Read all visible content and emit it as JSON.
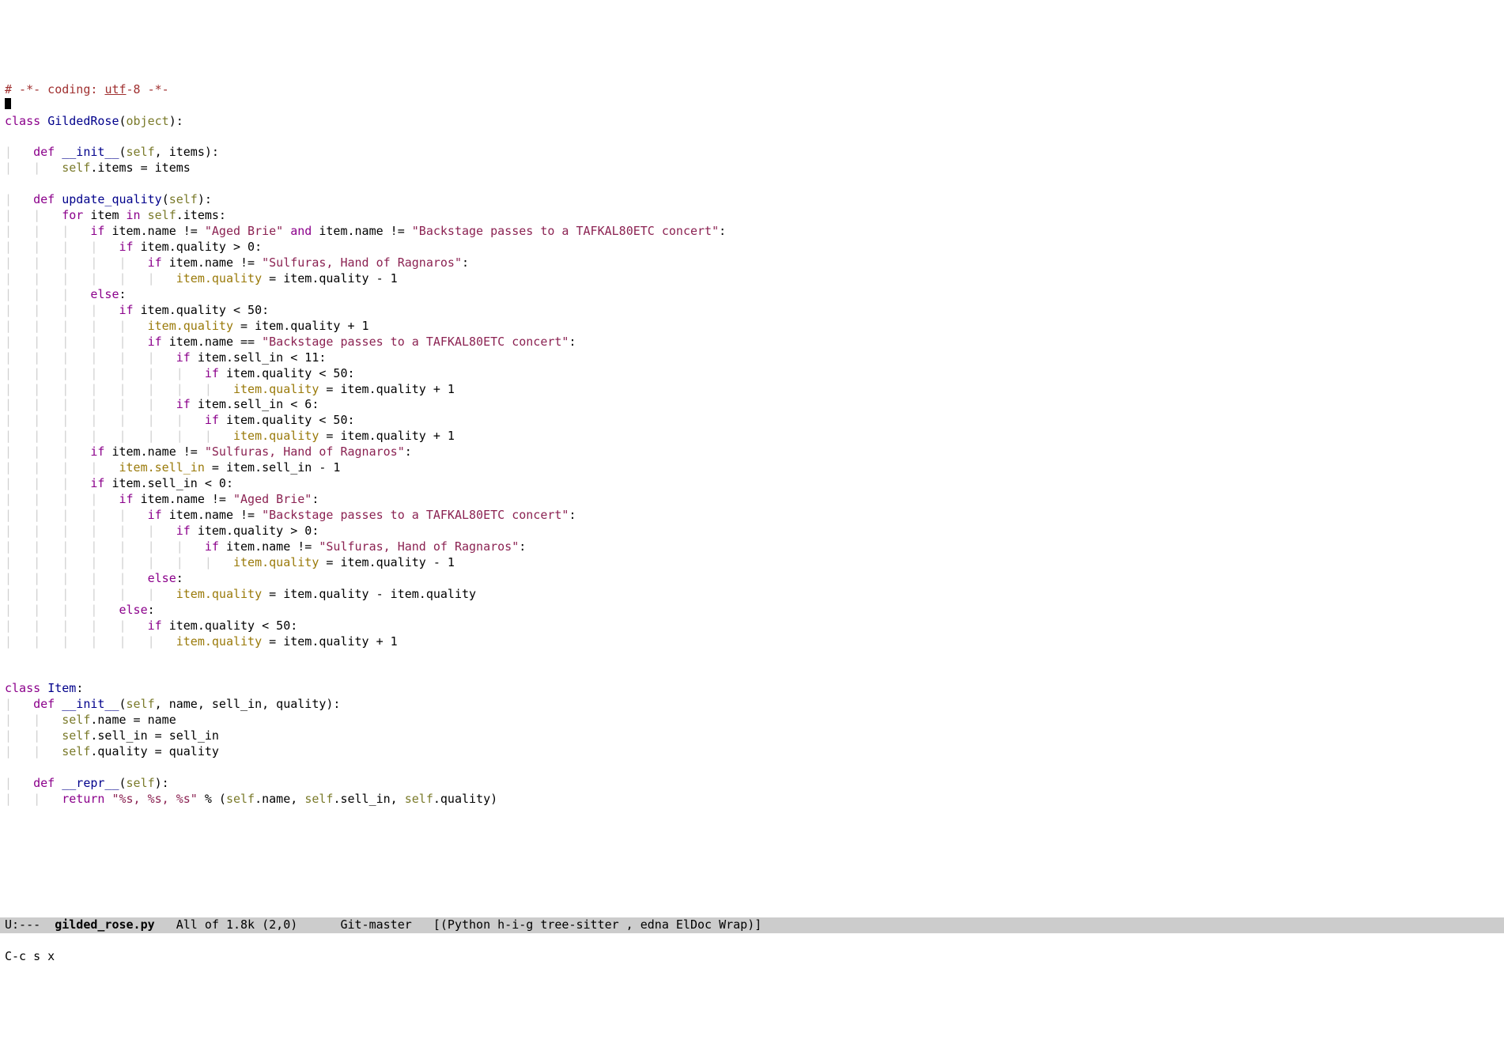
{
  "code": {
    "l1_pre": "# -*- coding: ",
    "l1_utf": "utf",
    "l1_post": "-8 -*-",
    "class_kw": "class",
    "def_kw": "def",
    "for_kw": "for",
    "in_kw": "in",
    "if_kw": "if",
    "else_kw": "else",
    "and_kw": "and",
    "return_kw": "return",
    "self": "self",
    "object": "object",
    "GildedRose": "GildedRose",
    "Item": "Item",
    "init": "__init__",
    "repr": "__repr__",
    "update_quality": "update_quality",
    "s_aged_brie": "\"Aged Brie\"",
    "s_backstage": "\"Backstage passes to a TAFKAL80ETC concert\"",
    "s_sulfuras": "\"Sulfuras, Hand of Ragnaros\"",
    "s_fmt": "\"%s, %s, %s\"",
    "item_quality": "item.quality",
    "item_sell_in": "item.sell_in"
  },
  "modeline": {
    "left": "U:---  ",
    "filename": "gilded_rose.py",
    "mid": "   All of 1.8k (2,0)      Git-master   [(Python h-i-g tree-sitter , edna ElDoc Wrap)]"
  },
  "minibuffer": "C-c s x"
}
